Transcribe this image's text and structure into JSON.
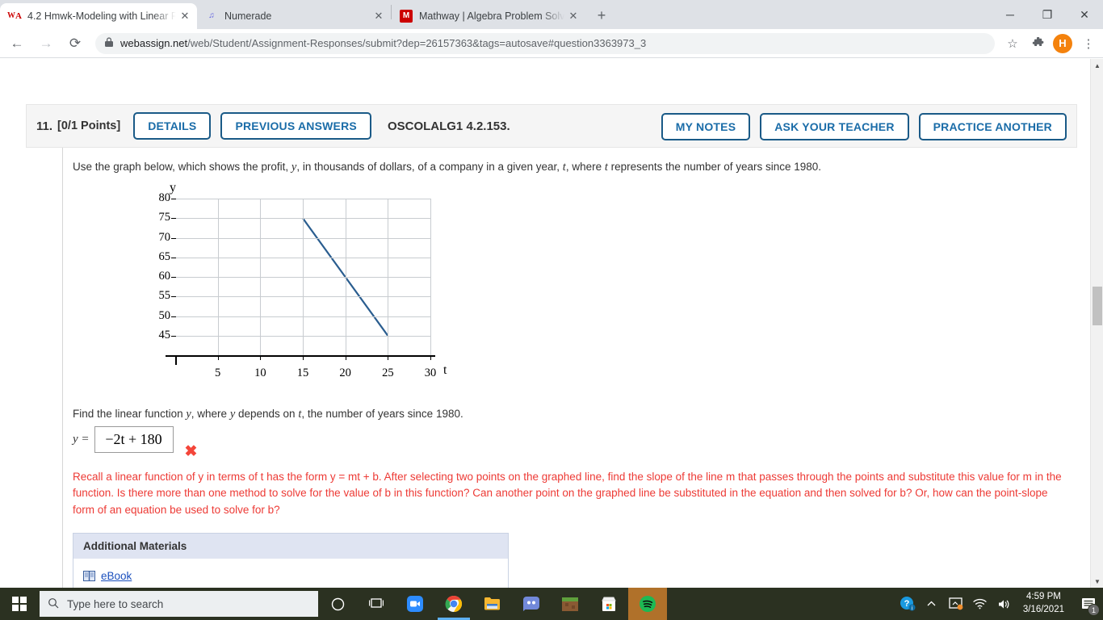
{
  "browser": {
    "tabs": [
      {
        "title": "4.2 Hmwk-Modeling with Linear F",
        "favicon": "webassign-icon",
        "active": true,
        "close_label": "✕"
      },
      {
        "title": "Numerade",
        "favicon": "numerade-icon",
        "active": false,
        "close_label": "✕"
      },
      {
        "title": "Mathway | Algebra Problem Solve",
        "favicon": "mathway-icon",
        "active": false,
        "close_label": "✕"
      }
    ],
    "new_tab_label": "+",
    "window_controls": {
      "minimize": "─",
      "maximize": "❐",
      "close": "✕"
    },
    "nav": {
      "back": "←",
      "forward": "→",
      "reload": "⟳"
    },
    "url_host": "webassign.net",
    "url_path": "/web/Student/Assignment-Responses/submit?dep=26157363&tags=autosave#question3363973_3",
    "lock_icon": "🔒",
    "bookmark_icon": "☆",
    "extensions_icon": "🧩",
    "profile_initial": "H",
    "menu_icon": "⋮"
  },
  "question": {
    "number": "11.",
    "points": "[0/1 Points]",
    "buttons_left": [
      {
        "label": "DETAILS"
      },
      {
        "label": "PREVIOUS ANSWERS"
      }
    ],
    "code": "OSCOLALG1 4.2.153.",
    "buttons_right": [
      {
        "label": "MY NOTES"
      },
      {
        "label": "ASK YOUR TEACHER"
      },
      {
        "label": "PRACTICE ANOTHER"
      }
    ],
    "prompt_part1": "Use the graph below, which shows the profit, ",
    "prompt_y": "y",
    "prompt_part2": ", in thousands of dollars, of a company in a given year, ",
    "prompt_t": "t",
    "prompt_part3": ", where ",
    "prompt_t2": "t",
    "prompt_part4": " represents the number of years since 1980.",
    "find_part1": "Find the linear function ",
    "find_y": "y",
    "find_part2": ", where ",
    "find_y2": "y",
    "find_part3": " depends on ",
    "find_t": "t",
    "find_part4": ", the number of years since 1980.",
    "answer_prefix": "y =",
    "answer_value": "−2t + 180",
    "answer_status_icon": "✖",
    "feedback": "Recall a linear function of y in terms of t has the form  y = mt + b.  After selecting two points on the graphed line, find the slope of the line m that passes through the points and substitute this value for m in the function. Is there more than one method to solve for the value of b in this function? Can another point on the graphed line be substituted in the equation and then solved for b? Or, how can the point-slope form of an equation be used to solve for b?",
    "additional_materials": {
      "title": "Additional Materials",
      "link_label": "eBook",
      "link_icon": "book-icon"
    }
  },
  "chart_data": {
    "type": "line",
    "title": "",
    "xlabel": "t",
    "ylabel": "y",
    "xlim": [
      0,
      30
    ],
    "ylim": [
      40,
      80
    ],
    "xticks": [
      5,
      10,
      15,
      20,
      25,
      30
    ],
    "yticks": [
      45,
      50,
      55,
      60,
      65,
      70,
      75,
      80
    ],
    "grid": true,
    "legend": "none",
    "series": [
      {
        "name": "profit",
        "color": "#2a5d8f",
        "points": [
          {
            "x": 15,
            "y": 75
          },
          {
            "x": 25,
            "y": 45
          }
        ]
      }
    ]
  },
  "taskbar": {
    "start_icon": "windows-icon",
    "search_placeholder": "Type here to search",
    "search_icon": "⚲",
    "items": [
      {
        "name": "cortana-icon",
        "glyph": "○"
      },
      {
        "name": "task-view-icon",
        "glyph": "⧉"
      },
      {
        "name": "zoom-icon",
        "glyph": "▶"
      },
      {
        "name": "chrome-icon",
        "glyph": ""
      },
      {
        "name": "file-explorer-icon",
        "glyph": ""
      },
      {
        "name": "discord-icon",
        "glyph": ""
      },
      {
        "name": "minecraft-icon",
        "glyph": ""
      },
      {
        "name": "microsoft-store-icon",
        "glyph": ""
      },
      {
        "name": "spotify-icon",
        "glyph": ""
      }
    ],
    "tray": [
      {
        "name": "help-icon",
        "glyph": "?"
      },
      {
        "name": "show-hidden-icons-icon",
        "glyph": "⌃"
      },
      {
        "name": "onedrive-sync-icon",
        "glyph": "❑"
      },
      {
        "name": "wifi-icon",
        "glyph": "◠"
      },
      {
        "name": "volume-icon",
        "glyph": "🔊"
      }
    ],
    "time": "4:59 PM",
    "date": "3/16/2021",
    "notification_count": "1"
  }
}
